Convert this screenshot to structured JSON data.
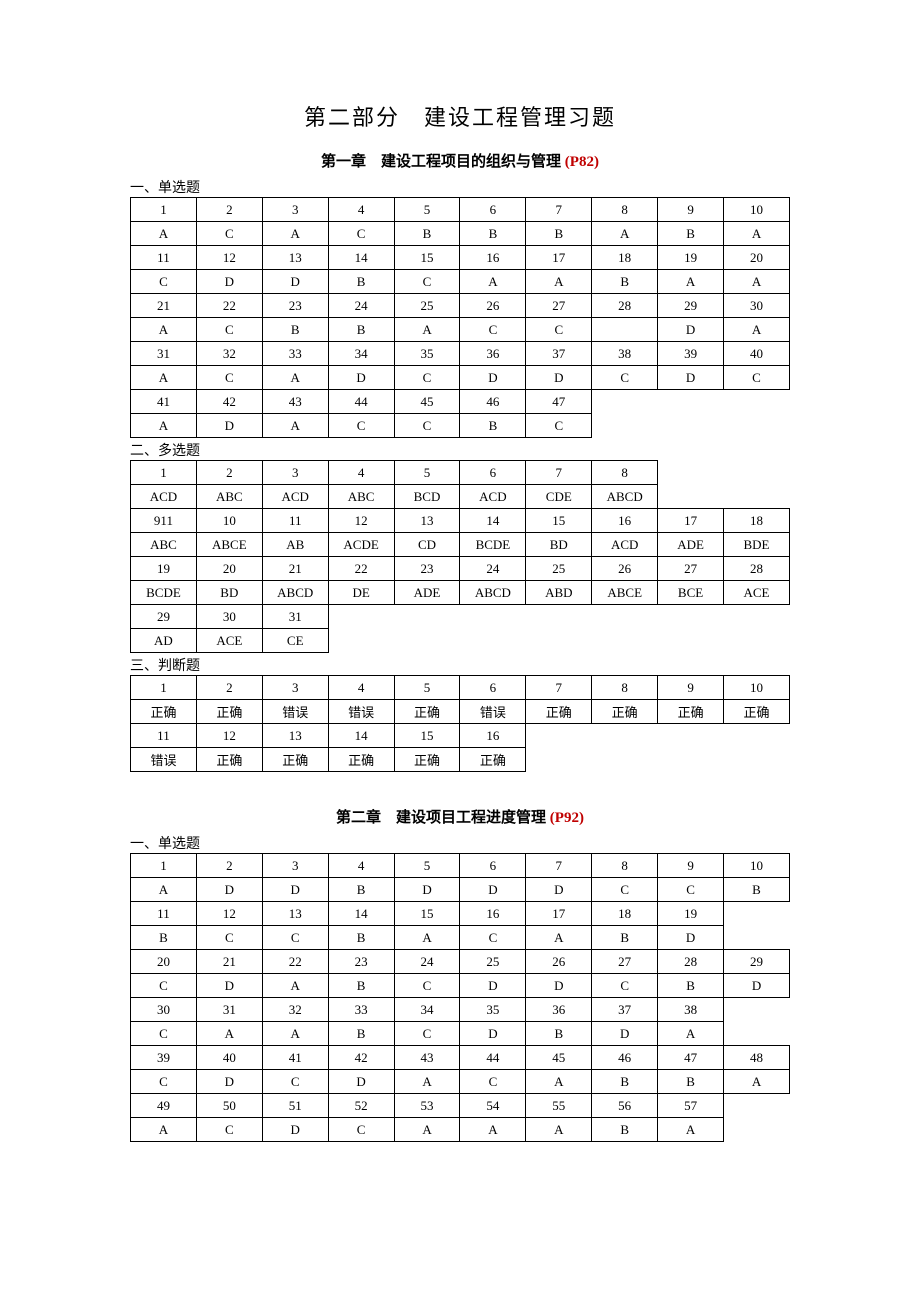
{
  "title": "第二部分　建设工程管理习题",
  "chapters": [
    {
      "heading_prefix": "第一章　建设工程项目的组织与管理",
      "heading_ref": "(P82)",
      "sections": [
        {
          "label": "一、单选题",
          "cols": 10,
          "rows": [
            [
              "1",
              "2",
              "3",
              "4",
              "5",
              "6",
              "7",
              "8",
              "9",
              "10"
            ],
            [
              "A",
              "C",
              "A",
              "C",
              "B",
              "B",
              "B",
              "A",
              "B",
              "A"
            ],
            [
              "11",
              "12",
              "13",
              "14",
              "15",
              "16",
              "17",
              "18",
              "19",
              "20"
            ],
            [
              "C",
              "D",
              "D",
              "B",
              "C",
              "A",
              "A",
              "B",
              "A",
              "A"
            ],
            [
              "21",
              "22",
              "23",
              "24",
              "25",
              "26",
              "27",
              "28",
              "29",
              "30"
            ],
            [
              "A",
              "C",
              "B",
              "B",
              "A",
              "C",
              "C",
              "",
              "D",
              "A"
            ],
            [
              "31",
              "32",
              "33",
              "34",
              "35",
              "36",
              "37",
              "38",
              "39",
              "40"
            ],
            [
              "A",
              "C",
              "A",
              "D",
              "C",
              "D",
              "D",
              "C",
              "D",
              "C"
            ],
            [
              "41",
              "42",
              "43",
              "44",
              "45",
              "46",
              "47"
            ],
            [
              "A",
              "D",
              "A",
              "C",
              "C",
              "B",
              "C"
            ]
          ]
        },
        {
          "label": "二、多选题",
          "cols": 10,
          "rows": [
            [
              "1",
              "2",
              "3",
              "4",
              "5",
              "6",
              "7",
              "8"
            ],
            [
              "ACD",
              "ABC",
              "ACD",
              "ABC",
              "BCD",
              "ACD",
              "CDE",
              "ABCD"
            ],
            [
              "911",
              "10",
              "11",
              "12",
              "13",
              "14",
              "15",
              "16",
              "17",
              "18"
            ],
            [
              "ABC",
              "ABCE",
              "AB",
              "ACDE",
              "CD",
              "BCDE",
              "BD",
              "ACD",
              "ADE",
              "BDE"
            ],
            [
              "19",
              "20",
              "21",
              "22",
              "23",
              "24",
              "25",
              "26",
              "27",
              "28"
            ],
            [
              "BCDE",
              "BD",
              "ABCD",
              "DE",
              "ADE",
              "ABCD",
              "ABD",
              "ABCE",
              "BCE",
              "ACE"
            ],
            [
              "29",
              "30",
              "31"
            ],
            [
              "AD",
              "ACE",
              "CE"
            ]
          ]
        },
        {
          "label": "三、判断题",
          "cols": 10,
          "rows": [
            [
              "1",
              "2",
              "3",
              "4",
              "5",
              "6",
              "7",
              "8",
              "9",
              "10"
            ],
            [
              "正确",
              "正确",
              "错误",
              "错误",
              "正确",
              "错误",
              "正确",
              "正确",
              "正确",
              "正确"
            ],
            [
              "11",
              "12",
              "13",
              "14",
              "15",
              "16"
            ],
            [
              "错误",
              "正确",
              "正确",
              "正确",
              "正确",
              "正确"
            ]
          ]
        }
      ]
    },
    {
      "heading_prefix": "第二章　建设项目工程进度管理",
      "heading_ref": "(P92)",
      "sections": [
        {
          "label": "一、单选题",
          "cols": 10,
          "rows": [
            [
              "1",
              "2",
              "3",
              "4",
              "5",
              "6",
              "7",
              "8",
              "9",
              "10"
            ],
            [
              "A",
              "D",
              "D",
              "B",
              "D",
              "D",
              "D",
              "C",
              "C",
              "B"
            ],
            [
              "11",
              "12",
              "13",
              "14",
              "15",
              "16",
              "17",
              "18",
              "19"
            ],
            [
              "B",
              "C",
              "C",
              "B",
              "A",
              "C",
              "A",
              "B",
              "D"
            ],
            [
              "20",
              "21",
              "22",
              "23",
              "24",
              "25",
              "26",
              "27",
              "28",
              "29"
            ],
            [
              "C",
              "D",
              "A",
              "B",
              "C",
              "D",
              "D",
              "C",
              "B",
              "D"
            ],
            [
              "30",
              "31",
              "32",
              "33",
              "34",
              "35",
              "36",
              "37",
              "38"
            ],
            [
              "C",
              "A",
              "A",
              "B",
              "C",
              "D",
              "B",
              "D",
              "A"
            ],
            [
              "39",
              "40",
              "41",
              "42",
              "43",
              "44",
              "45",
              "46",
              "47",
              "48"
            ],
            [
              "C",
              "D",
              "C",
              "D",
              "A",
              "C",
              "A",
              "B",
              "B",
              "A"
            ],
            [
              "49",
              "50",
              "51",
              "52",
              "53",
              "54",
              "55",
              "56",
              "57"
            ],
            [
              "A",
              "C",
              "D",
              "C",
              "A",
              "A",
              "A",
              "B",
              "A"
            ]
          ]
        }
      ]
    }
  ]
}
